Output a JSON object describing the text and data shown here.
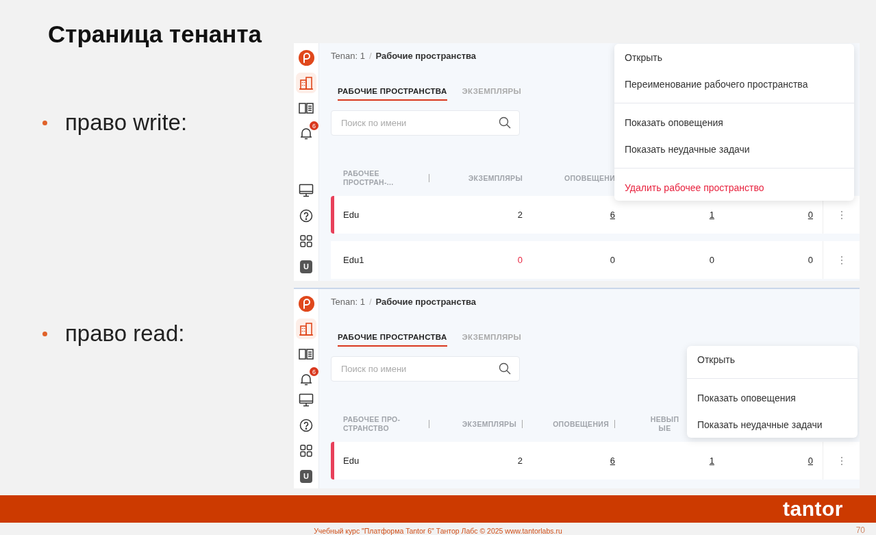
{
  "slide": {
    "title": "Страница тенанта"
  },
  "sections": [
    {
      "bullet": "право write:",
      "screen": {
        "nav_top": [
          {
            "kind": "logo",
            "selected": false
          },
          {
            "kind": "buildings",
            "selected": true
          },
          {
            "kind": "book",
            "selected": false
          },
          {
            "kind": "bell",
            "selected": false,
            "badge": "6"
          }
        ],
        "nav_bottom": [
          {
            "kind": "monitor",
            "selected": false
          },
          {
            "kind": "help",
            "selected": false
          },
          {
            "kind": "grid",
            "selected": false
          },
          {
            "kind": "avatar",
            "selected": false,
            "text": "U"
          }
        ],
        "breadcrumb": {
          "parent": "Tenan: 1",
          "separator": "/",
          "current": "Рабочие пространства"
        },
        "tabs": [
          {
            "label": "РАБОЧИЕ ПРОСТРАНСТВА",
            "selected": true
          },
          {
            "label": "ЭКЗЕМПЛЯРЫ",
            "selected": false
          }
        ],
        "search": {
          "placeholder": "Поиск по имени"
        },
        "table": {
          "columns": [
            {
              "label": "РАБОЧЕЕ ПРОСТРАН-...",
              "resizer": true
            },
            {
              "label": "ЭКЗЕМПЛЯРЫ",
              "resizer": false
            },
            {
              "label": "ОПОВЕЩЕНИ",
              "resizer": false
            }
          ],
          "rows": [
            {
              "selected": true,
              "cells": [
                {
                  "text": "Edu",
                  "link": false,
                  "alert": false
                },
                {
                  "text": "2",
                  "link": false,
                  "alert": false
                },
                {
                  "text": "6",
                  "link": true,
                  "alert": false
                },
                {
                  "text": "1",
                  "link": true,
                  "alert": false
                },
                {
                  "text": "0",
                  "link": true,
                  "alert": false
                }
              ]
            },
            {
              "selected": false,
              "cells": [
                {
                  "text": "Edu1",
                  "link": false,
                  "alert": false
                },
                {
                  "text": "0",
                  "link": false,
                  "alert": true
                },
                {
                  "text": "0",
                  "link": false,
                  "alert": false
                },
                {
                  "text": "0",
                  "link": false,
                  "alert": false
                },
                {
                  "text": "0",
                  "link": false,
                  "alert": false
                }
              ]
            }
          ]
        },
        "menu": {
          "items": [
            {
              "label": "Открыть",
              "kind": "normal",
              "divider_after": false
            },
            {
              "label": "Переименование рабочего пространства",
              "kind": "normal",
              "divider_after": true
            },
            {
              "label": "Показать оповещения",
              "kind": "normal",
              "divider_after": false
            },
            {
              "label": "Показать неудачные задачи",
              "kind": "normal",
              "divider_after": true
            },
            {
              "label": "Удалить рабочее пространство",
              "kind": "danger",
              "divider_after": false
            }
          ]
        }
      }
    },
    {
      "bullet": "право read:",
      "screen": {
        "nav_top": [
          {
            "kind": "logo",
            "selected": false
          },
          {
            "kind": "buildings",
            "selected": true
          },
          {
            "kind": "book",
            "selected": false
          },
          {
            "kind": "bell",
            "selected": false,
            "badge": "6"
          }
        ],
        "nav_bottom": [
          {
            "kind": "monitor",
            "selected": false
          },
          {
            "kind": "help",
            "selected": false
          },
          {
            "kind": "grid",
            "selected": false
          },
          {
            "kind": "avatar",
            "selected": false,
            "text": "U"
          }
        ],
        "breadcrumb": {
          "parent": "Tenan: 1",
          "separator": "/",
          "current": "Рабочие пространства"
        },
        "tabs": [
          {
            "label": "РАБОЧИЕ ПРОСТРАНСТВА",
            "selected": true
          },
          {
            "label": "ЭКЗЕМПЛЯРЫ",
            "selected": false
          }
        ],
        "search": {
          "placeholder": "Поиск по имени"
        },
        "table": {
          "columns": [
            {
              "label": "РАБОЧЕЕ ПРО-СТРАНСТВО",
              "resizer": true
            },
            {
              "label": "ЭКЗЕМПЛЯРЫ",
              "resizer": true
            },
            {
              "label": "ОПОВЕЩЕНИЯ",
              "resizer": true
            },
            {
              "label": "НЕВЫП ЫЕ",
              "resizer": false
            }
          ],
          "rows": [
            {
              "selected": true,
              "cells": [
                {
                  "text": "Edu",
                  "link": false,
                  "alert": false
                },
                {
                  "text": "2",
                  "link": false,
                  "alert": false
                },
                {
                  "text": "6",
                  "link": true,
                  "alert": false
                },
                {
                  "text": "1",
                  "link": true,
                  "alert": false
                },
                {
                  "text": "0",
                  "link": true,
                  "alert": false
                }
              ]
            }
          ]
        },
        "menu": {
          "items": [
            {
              "label": "Открыть",
              "kind": "normal",
              "divider_after": true
            },
            {
              "label": "Показать оповещения",
              "kind": "normal",
              "divider_after": false
            },
            {
              "label": "Показать неудачные задачи",
              "kind": "normal",
              "divider_after": false
            }
          ]
        }
      }
    }
  ],
  "footer": {
    "logo": "tantor",
    "course": "Учебный курс \"Платформа Tantor 6\" Тантор Лабс © 2025  www.tantorlabs.ru",
    "page": "70"
  }
}
